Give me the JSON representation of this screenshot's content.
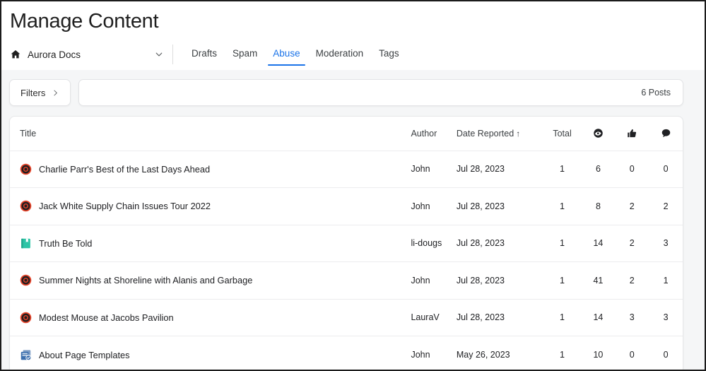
{
  "page": {
    "title": "Manage Content"
  },
  "site_selector": {
    "icon": "home-icon",
    "name": "Aurora Docs",
    "chevron": "chevron-down-icon"
  },
  "tabs": [
    {
      "label": "Drafts",
      "active": false
    },
    {
      "label": "Spam",
      "active": false
    },
    {
      "label": "Abuse",
      "active": true
    },
    {
      "label": "Moderation",
      "active": false
    },
    {
      "label": "Tags",
      "active": false
    }
  ],
  "toolbar": {
    "filters_label": "Filters",
    "filters_chevron": "chevron-right-icon",
    "search_value": "",
    "search_placeholder": "",
    "post_count": "6 Posts"
  },
  "table": {
    "columns": [
      {
        "key": "title",
        "label": "Title",
        "icon": null,
        "sorted": false
      },
      {
        "key": "author",
        "label": "Author",
        "icon": null,
        "sorted": false
      },
      {
        "key": "date",
        "label": "Date Reported",
        "icon": null,
        "sorted": true,
        "sort_dir": "↑"
      },
      {
        "key": "total",
        "label": "Total",
        "icon": null,
        "sorted": false
      },
      {
        "key": "views",
        "label": "",
        "icon": "eye-icon",
        "sorted": false
      },
      {
        "key": "likes",
        "label": "",
        "icon": "thumbs-up-icon",
        "sorted": false
      },
      {
        "key": "comments",
        "label": "",
        "icon": "comment-icon",
        "sorted": false
      }
    ],
    "rows": [
      {
        "icon": "blog-post-icon",
        "title": "Charlie Parr's Best of the Last Days Ahead",
        "author": "John",
        "date": "Jul 28, 2023",
        "total": "1",
        "views": "6",
        "likes": "0",
        "comments": "0"
      },
      {
        "icon": "blog-post-icon",
        "title": "Jack White Supply Chain Issues Tour 2022",
        "author": "John",
        "date": "Jul 28, 2023",
        "total": "1",
        "views": "8",
        "likes": "2",
        "comments": "2"
      },
      {
        "icon": "book-icon",
        "title": "Truth Be Told",
        "author": "li-dougs",
        "date": "Jul 28, 2023",
        "total": "1",
        "views": "14",
        "likes": "2",
        "comments": "3"
      },
      {
        "icon": "blog-post-icon",
        "title": "Summer Nights at Shoreline with Alanis and Garbage",
        "author": "John",
        "date": "Jul 28, 2023",
        "total": "1",
        "views": "41",
        "likes": "2",
        "comments": "1"
      },
      {
        "icon": "blog-post-icon",
        "title": "Modest Mouse at Jacobs Pavilion",
        "author": "LauraV",
        "date": "Jul 28, 2023",
        "total": "1",
        "views": "14",
        "likes": "3",
        "comments": "3"
      },
      {
        "icon": "page-template-icon",
        "title": "About Page Templates",
        "author": "John",
        "date": "May 26, 2023",
        "total": "1",
        "views": "10",
        "likes": "0",
        "comments": "0"
      }
    ]
  },
  "colors": {
    "accent_blue": "#1a73e8",
    "page_bg": "#f5f6f7",
    "card_bg": "#ffffff",
    "text_primary": "#202124",
    "blog_icon_ring": "#e8442a",
    "book_icon": "#2ec4a6",
    "page_icon": "#3c6fae"
  }
}
